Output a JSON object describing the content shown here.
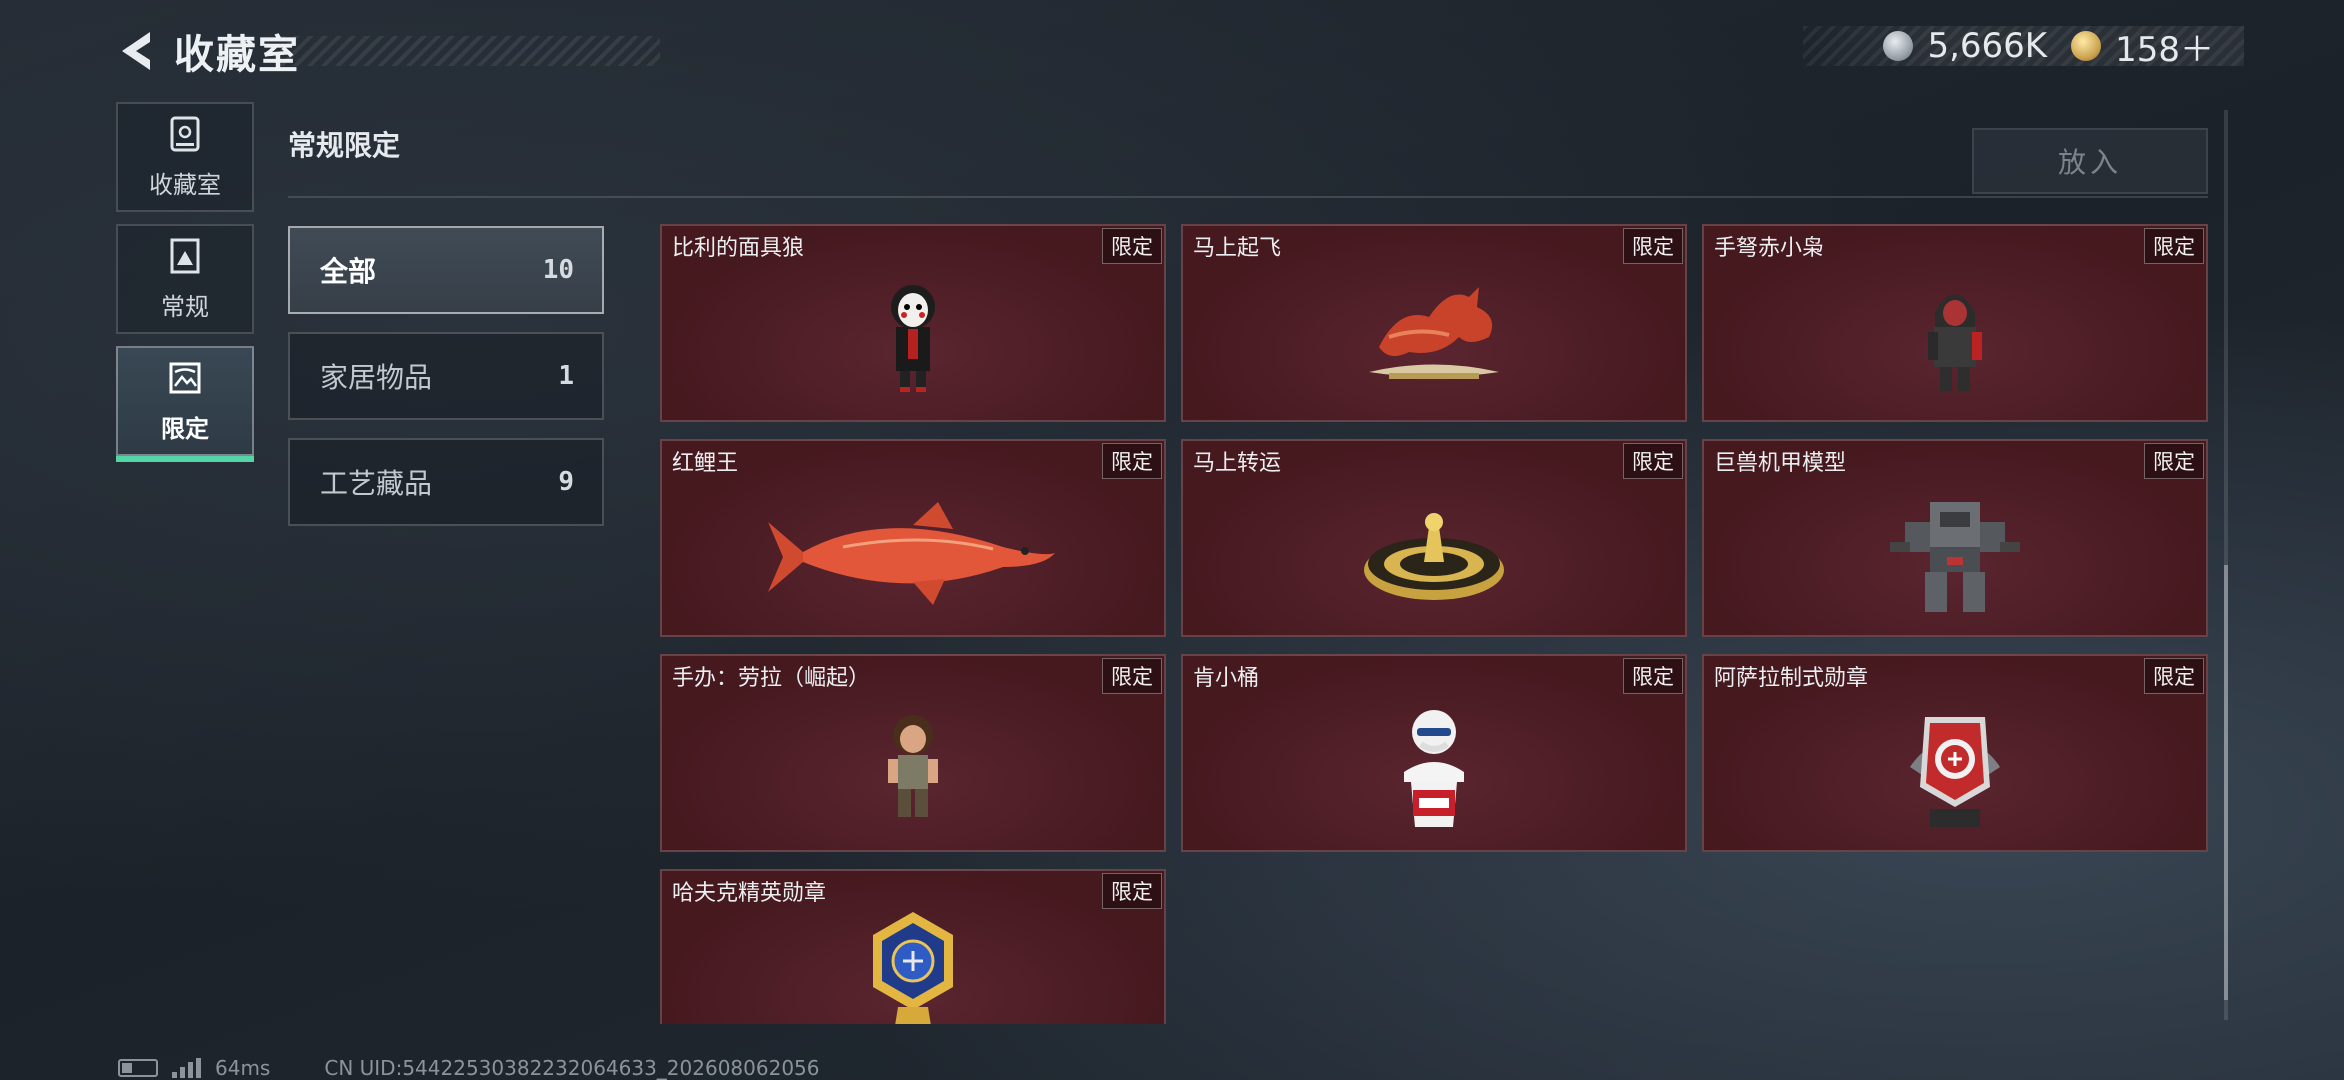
{
  "header": {
    "title": "收藏室",
    "back_icon": "back-arrow-icon"
  },
  "currency": {
    "silver": "5,666K",
    "gold": "158＋"
  },
  "sidenav": [
    {
      "label": "收藏室",
      "icon": "cabinet-icon"
    },
    {
      "label": "常规",
      "icon": "photo-frame-icon"
    },
    {
      "label": "限定",
      "icon": "landscape-icon",
      "active": true
    }
  ],
  "section": {
    "title": "常规限定",
    "put_button": "放入"
  },
  "categories": [
    {
      "name": "全部",
      "count": "10",
      "active": true
    },
    {
      "name": "家居物品",
      "count": "1"
    },
    {
      "name": "工艺藏品",
      "count": "9"
    }
  ],
  "tag_label": "限定",
  "items": [
    {
      "name": "比利的面具狼",
      "art": "masked-doll-icon"
    },
    {
      "name": "马上起飞",
      "art": "red-horse-icon"
    },
    {
      "name": "手弩赤小枭",
      "art": "hooded-figure-icon"
    },
    {
      "name": "红鲤王",
      "art": "red-carp-icon"
    },
    {
      "name": "马上转运",
      "art": "golden-wheel-icon"
    },
    {
      "name": "巨兽机甲模型",
      "art": "mech-model-icon"
    },
    {
      "name": "手办：劳拉（崛起）",
      "art": "lara-figure-icon"
    },
    {
      "name": "肯小桶",
      "art": "colonel-figure-icon"
    },
    {
      "name": "阿萨拉制式勋章",
      "art": "red-medal-icon"
    },
    {
      "name": "哈夫克精英勋章",
      "art": "gold-medal-icon"
    }
  ],
  "footer": {
    "ping": "64ms",
    "uid": "CN UID:5442253038223206463​3_202608062056"
  },
  "colors": {
    "card_bg": "#4a1c24",
    "active_accent": "#53d6a6"
  }
}
